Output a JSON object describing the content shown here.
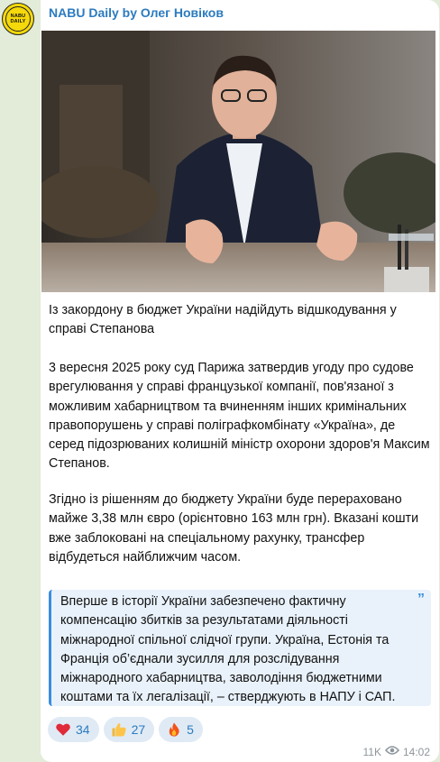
{
  "channel": {
    "avatar_text_line1": "NABU",
    "avatar_text_line2": "DAILY",
    "sender_name": "NABU Daily by Олег Новіков"
  },
  "post": {
    "headline": "Із закордону в бюджет України надійдуть відшкодування у справі Степанова",
    "paragraph1": "3 вересня 2025 року суд Парижа затвердив угоду про судове врегулювання у справі французької компанії, пов'язаної з можливим хабарництвом та вчиненням інших кримінальних правопорушень у справі поліграфкомбінату «Україна», де серед підозрюваних колишній міністр охорони здоров'я Максим Степанов.",
    "paragraph2": "Згідно із рішенням до бюджету України буде перераховано майже 3,38 млн євро (орієнтовно 163 млн грн). Вказані кошти вже заблоковані на спеціальному рахунку, трансфер відбудеться найближчим часом.",
    "quote": "Вперше в історії України забезпечено фактичну компенсацію збитків за результатами діяльності міжнародної спільної слідчої групи. Україна, Естонія та Франція об’єднали зусилля для розслідування міжнародного хабарництва, заволодіння бюджетними коштами та їх легалізації, – стверджують в НАПУ і САП."
  },
  "reactions": [
    {
      "icon": "heart-icon",
      "count": "34"
    },
    {
      "icon": "thumbs-up-icon",
      "count": "27"
    },
    {
      "icon": "fire-icon",
      "count": "5"
    }
  ],
  "meta": {
    "views": "11K",
    "views_icon": "eye-icon",
    "time": "14:02"
  },
  "colors": {
    "background": "#e3ebd9",
    "sender": "#2b7bbf",
    "quote_accent": "#3a8ede",
    "quote_bg": "#e9f2fb",
    "reaction_bg": "#dfeaf5",
    "avatar": "#f5d90a"
  }
}
